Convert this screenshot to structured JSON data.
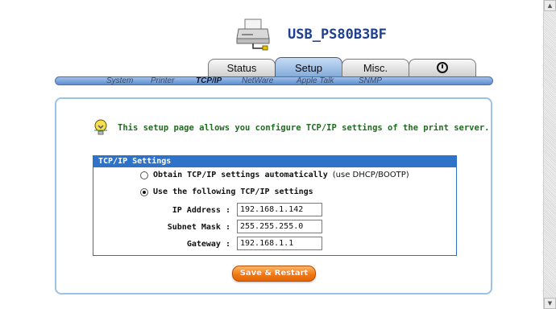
{
  "header": {
    "device_name": "USB_PS80B3BF"
  },
  "tabs": [
    {
      "label": "Status"
    },
    {
      "label": "Setup"
    },
    {
      "label": "Misc."
    }
  ],
  "subnav": [
    {
      "label": "System"
    },
    {
      "label": "Printer"
    },
    {
      "label": "TCP/IP"
    },
    {
      "label": "NetWare"
    },
    {
      "label": "Apple Talk"
    },
    {
      "label": "SNMP"
    }
  ],
  "hint": "This setup page allows you configure TCP/IP settings of the print server.",
  "settings": {
    "title": "TCP/IP Settings",
    "option_auto": "Obtain TCP/IP settings automatically",
    "option_auto_note": "(use DHCP/BOOTP)",
    "option_manual": "Use the following TCP/IP settings",
    "selected": "manual",
    "ip_label": "IP Address :",
    "ip_value": "192.168.1.142",
    "mask_label": "Subnet Mask :",
    "mask_value": "255.255.255.0",
    "gw_label": "Gateway :",
    "gw_value": "192.168.1.1"
  },
  "save_button": "Save & Restart",
  "colors": {
    "accent": "#2f73c9",
    "title": "#1f3f8f",
    "hint": "#1f6b1f",
    "button": "#f07a12"
  }
}
